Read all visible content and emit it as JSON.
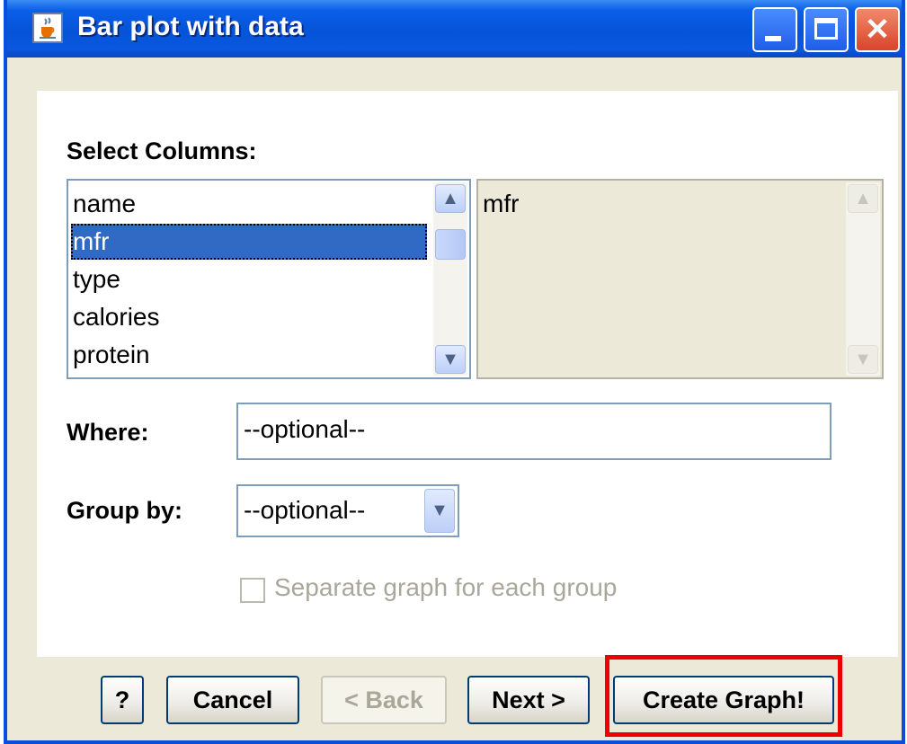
{
  "window": {
    "title": "Bar plot with data",
    "title_icon": "java-cup-icon",
    "controls": [
      "minimize-icon",
      "maximize-icon",
      "close-icon"
    ]
  },
  "select_columns": {
    "label": "Select Columns:",
    "available": [
      "name",
      "mfr",
      "type",
      "calories",
      "protein"
    ],
    "selected_index": 1,
    "chosen": [
      "mfr"
    ]
  },
  "where": {
    "label": "Where:",
    "value": "--optional--"
  },
  "group_by": {
    "label": "Group by:",
    "value": "--optional--"
  },
  "separate_graph": {
    "label": "Separate graph for each group",
    "checked": false,
    "enabled": false
  },
  "buttons": {
    "help": "?",
    "cancel": "Cancel",
    "back": "< Back",
    "next": "Next >",
    "create": "Create Graph!"
  },
  "colors": {
    "title_bar": "#0553d8",
    "selection": "#316ac5",
    "highlight": "#ee0000"
  }
}
